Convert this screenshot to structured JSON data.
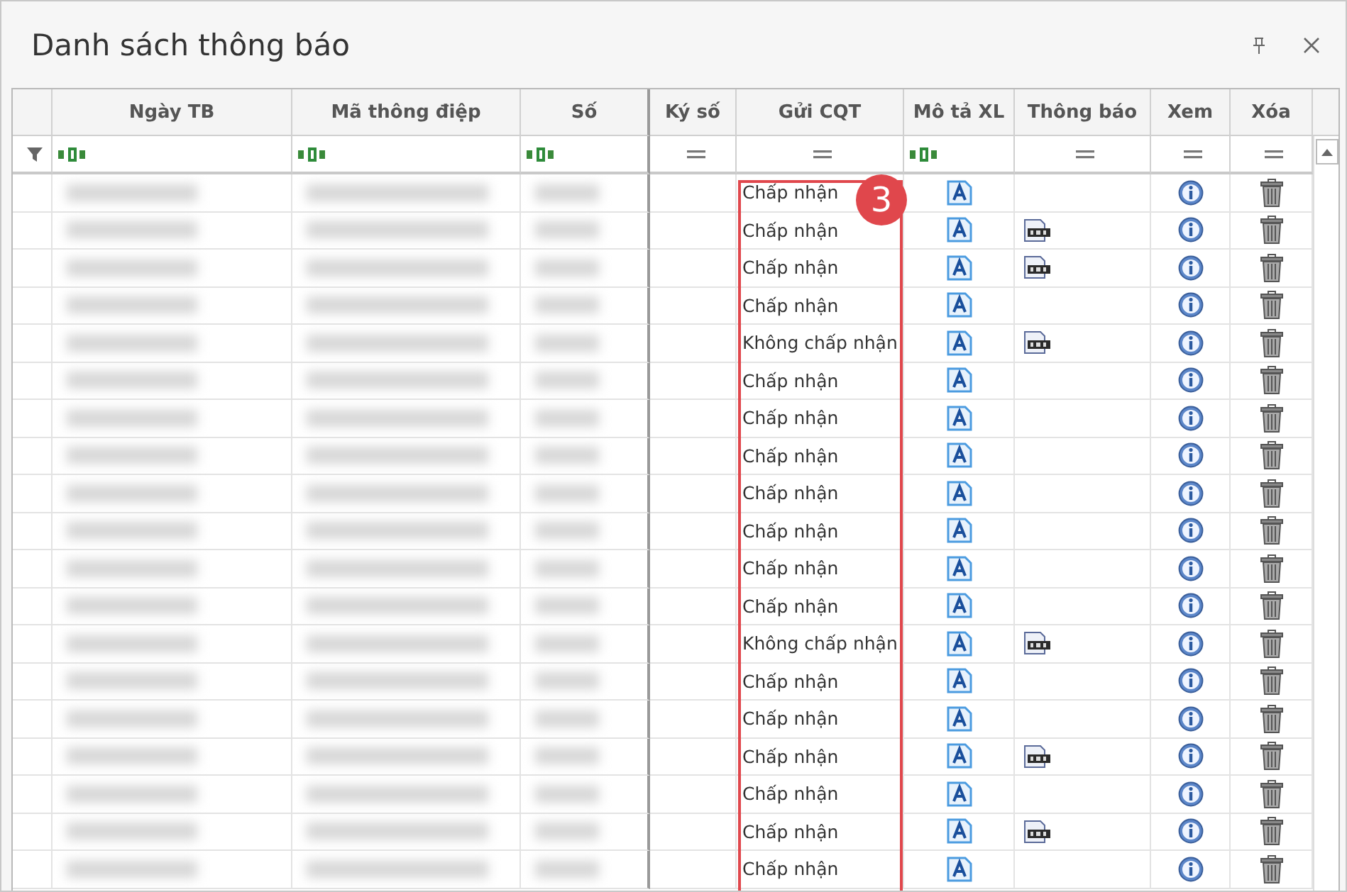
{
  "window": {
    "title": "Danh sách thông báo"
  },
  "table": {
    "columns": [
      {
        "label": "Ngày TB",
        "kind": "text"
      },
      {
        "label": "Mã thông điệp",
        "kind": "text"
      },
      {
        "label": "Số",
        "kind": "text"
      },
      {
        "label": "Ký số",
        "kind": "equals"
      },
      {
        "label": "Gửi CQT",
        "kind": "equals"
      },
      {
        "label": "Mô tả XL",
        "kind": "text"
      },
      {
        "label": "Thông báo",
        "kind": "equals"
      },
      {
        "label": "Xem",
        "kind": "equals"
      },
      {
        "label": "Xóa",
        "kind": "equals"
      }
    ],
    "rows": [
      {
        "status": "Chấp nhận",
        "has_xml": false
      },
      {
        "status": "Chấp nhận",
        "has_xml": true
      },
      {
        "status": "Chấp nhận",
        "has_xml": true
      },
      {
        "status": "Chấp nhận",
        "has_xml": false
      },
      {
        "status": "Không chấp nhận",
        "has_xml": true
      },
      {
        "status": "Chấp nhận",
        "has_xml": false
      },
      {
        "status": "Chấp nhận",
        "has_xml": false
      },
      {
        "status": "Chấp nhận",
        "has_xml": false
      },
      {
        "status": "Chấp nhận",
        "has_xml": false
      },
      {
        "status": "Chấp nhận",
        "has_xml": false
      },
      {
        "status": "Chấp nhận",
        "has_xml": false
      },
      {
        "status": "Chấp nhận",
        "has_xml": false
      },
      {
        "status": "Không chấp nhận",
        "has_xml": true
      },
      {
        "status": "Chấp nhận",
        "has_xml": false
      },
      {
        "status": "Chấp nhận",
        "has_xml": false
      },
      {
        "status": "Chấp nhận",
        "has_xml": true
      },
      {
        "status": "Chấp nhận",
        "has_xml": false
      },
      {
        "status": "Chấp nhận",
        "has_xml": true
      },
      {
        "status": "Chấp nhận",
        "has_xml": false
      }
    ]
  },
  "annotation": {
    "label": "3"
  }
}
